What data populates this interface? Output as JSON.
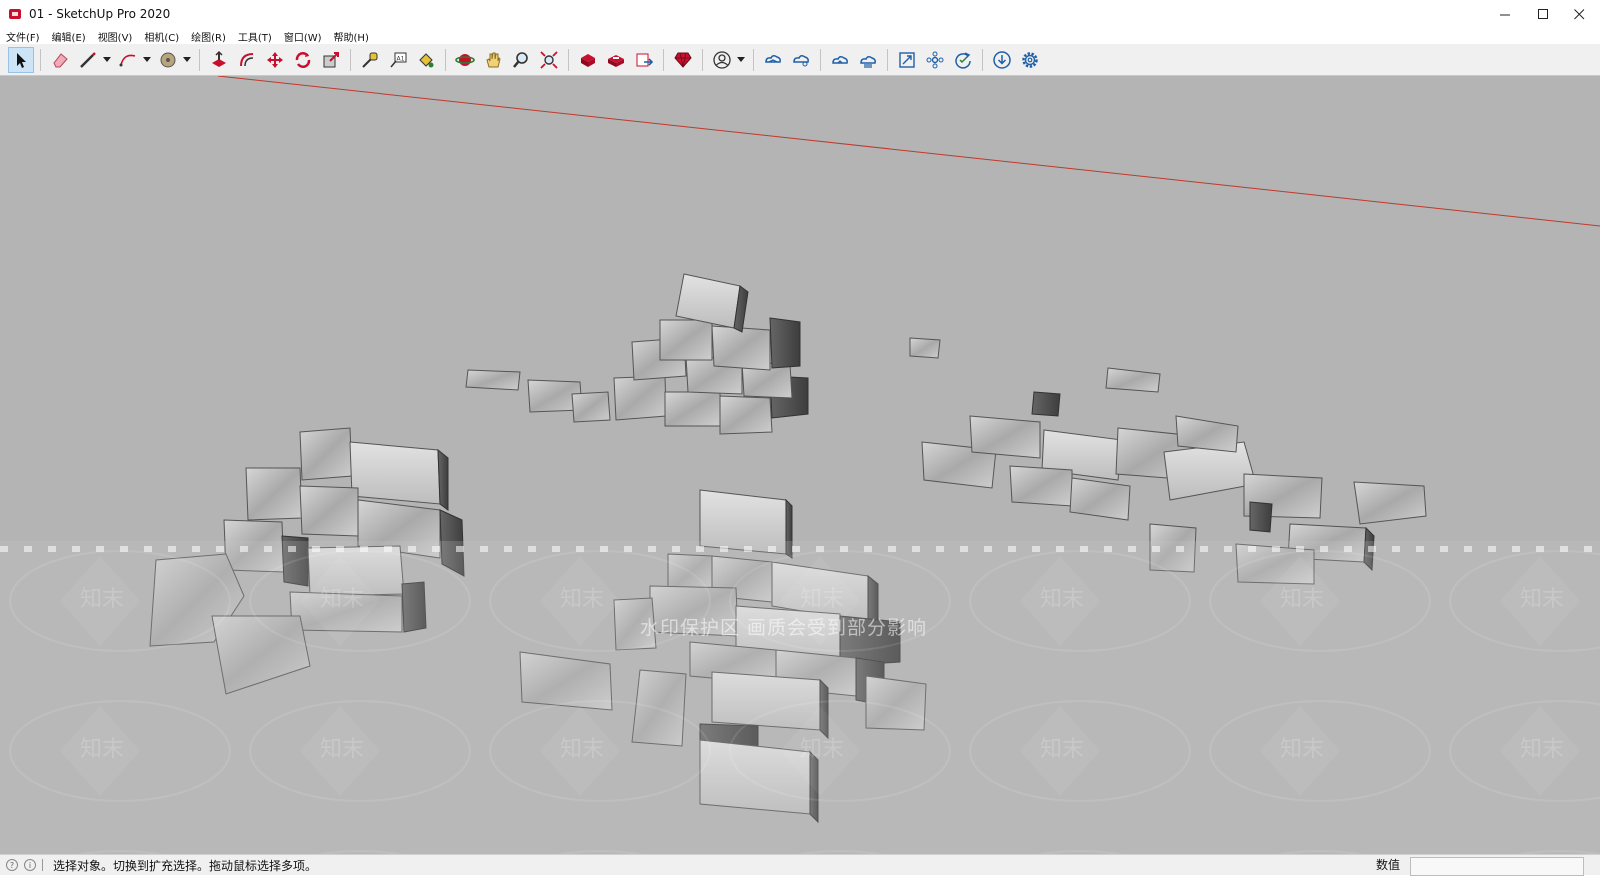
{
  "window": {
    "title": "01 - SketchUp Pro 2020",
    "controls": [
      "minimize-icon",
      "maximize-icon",
      "close-icon"
    ]
  },
  "menu": {
    "items": [
      {
        "label": "文件(F)"
      },
      {
        "label": "编辑(E)"
      },
      {
        "label": "视图(V)"
      },
      {
        "label": "相机(C)"
      },
      {
        "label": "绘图(R)"
      },
      {
        "label": "工具(T)"
      },
      {
        "label": "窗口(W)"
      },
      {
        "label": "帮助(H)"
      }
    ]
  },
  "toolbar": {
    "tools": [
      "select-icon",
      "eraser-icon",
      "line-icon",
      "arc-icon",
      "shape-icon",
      "push-pull-icon",
      "offset-icon",
      "move-icon",
      "rotate-icon",
      "scale-icon",
      "tape-measure-icon",
      "text-icon",
      "paint-bucket-icon",
      "orbit-icon",
      "pan-icon",
      "zoom-icon",
      "zoom-extents-icon",
      "3d-warehouse-icon",
      "extension-warehouse-icon",
      "send-to-layout-icon",
      "extension-manager-icon",
      "account-icon",
      "trimble-connect-icon",
      "trimble-share-icon",
      "cloud-sync-icon",
      "cloud-upload-icon",
      "fullscreen-icon",
      "components-icon",
      "refresh-icon",
      "download-icon",
      "settings-icon"
    ]
  },
  "viewport": {
    "background": "#b4b4b4",
    "horizon_color": "#c0392b",
    "watermark": "水印保护区  画质会受到部分影响",
    "watermark_logo": "知末"
  },
  "status": {
    "prompt": "选择对象。切换到扩充选择。拖动鼠标选择多项。",
    "measurements_label": "数值",
    "measurements_value": ""
  }
}
